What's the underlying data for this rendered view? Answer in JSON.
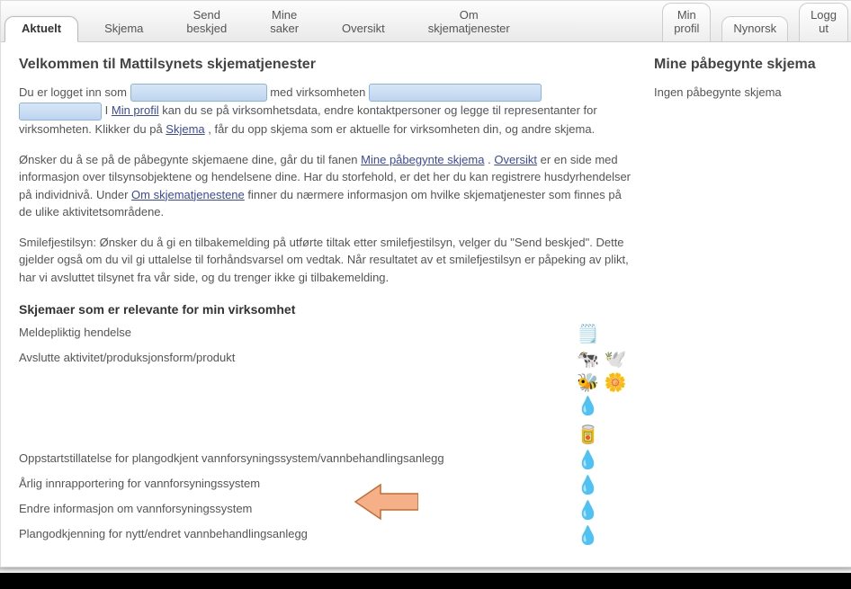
{
  "tabs": [
    {
      "id": "aktuelt",
      "label": "Aktuelt",
      "active": true
    },
    {
      "id": "skjema",
      "label": "Skjema"
    },
    {
      "id": "send-beskjed",
      "label": "Send\nbeskjed"
    },
    {
      "id": "mine-saker",
      "label": "Mine\nsaker"
    },
    {
      "id": "oversikt",
      "label": "Oversikt"
    },
    {
      "id": "om-skjematjenester",
      "label": "Om\nskjematjenester"
    }
  ],
  "tabs_right": [
    {
      "id": "min-profil",
      "label": "Min\nprofil"
    },
    {
      "id": "nynorsk",
      "label": "Nynorsk"
    },
    {
      "id": "logg-ut",
      "label": "Logg\nut"
    }
  ],
  "headings": {
    "main": "Velkommen til Mattilsynets skjematjenester",
    "side": "Mine påbegynte skjema",
    "relevant": "Skjemaer som er relevante for min virksomhet"
  },
  "side": {
    "empty": "Ingen påbegynte skjema"
  },
  "intro": {
    "p1a": "Du er logget inn som ",
    "p1b": " med virksomheten ",
    "p1c": " I ",
    "p1_link_minprofil": "Min profil",
    "p1d": " kan du se på virksomhetsdata, endre kontaktpersoner og legge til representanter for virksomheten. Klikker du på ",
    "p1_link_skjema": "Skjema",
    "p1e": ", får du opp skjema som er aktuelle for virksomheten din, og andre skjema.",
    "p2a": "Ønsker du å se på de påbegynte skjemaene dine, går du til fanen ",
    "p2_link_mine": "Mine påbegynte skjema",
    "p2b": ". ",
    "p2_link_oversikt": "Oversikt",
    "p2c": " er en side med informasjon over tilsynsobjektene og hendelsene dine. Har du storfehold, er det her du kan registrere husdyrhendelser på individnivå. Under ",
    "p2_link_om": "Om skjematjenestene",
    "p2d": " finner du nærmere informasjon om hvilke skjematjenester som finnes på de ulike aktivitetsområdene.",
    "p3": "Smilefjestilsyn: Ønsker du å gi en tilbakemelding på utførte tiltak etter smilefjestilsyn, velger du \"Send beskjed\". Dette gjelder også om du vil gi uttalelse til forhåndsvarsel om vedtak. Når resultatet av et smilefjestilsyn er påpeking av plikt, har vi avsluttet tilsynet fra vår side, og du trenger ikke gi tilbakemelding."
  },
  "forms": [
    {
      "name": "Meldepliktig hendelse",
      "icons": [
        "notepad"
      ]
    },
    {
      "name": "Avslutte aktivitet/produksjonsform/produkt",
      "icons": [
        "cow",
        "bird",
        "bee",
        "flower",
        "drop",
        "jar"
      ]
    },
    {
      "name": "Oppstartstillatelse for plangodkjent vannforsyningssystem/vannbehandlingsanlegg",
      "icons": [
        "drop"
      ]
    },
    {
      "name": "Årlig innrapportering for vannforsyningssystem",
      "icons": [
        "drop"
      ],
      "highlight": true
    },
    {
      "name": "Endre informasjon om vannforsyningssystem",
      "icons": [
        "drop"
      ]
    },
    {
      "name": "Plangodkjenning for nytt/endret vannbehandlingsanlegg",
      "icons": [
        "drop"
      ]
    }
  ],
  "icon_glyphs": {
    "notepad": "🗒️",
    "cow": "🐄",
    "bird": "🕊️",
    "bee": "🐝",
    "flower": "🌼",
    "drop": "💧",
    "jar": "🥫"
  }
}
